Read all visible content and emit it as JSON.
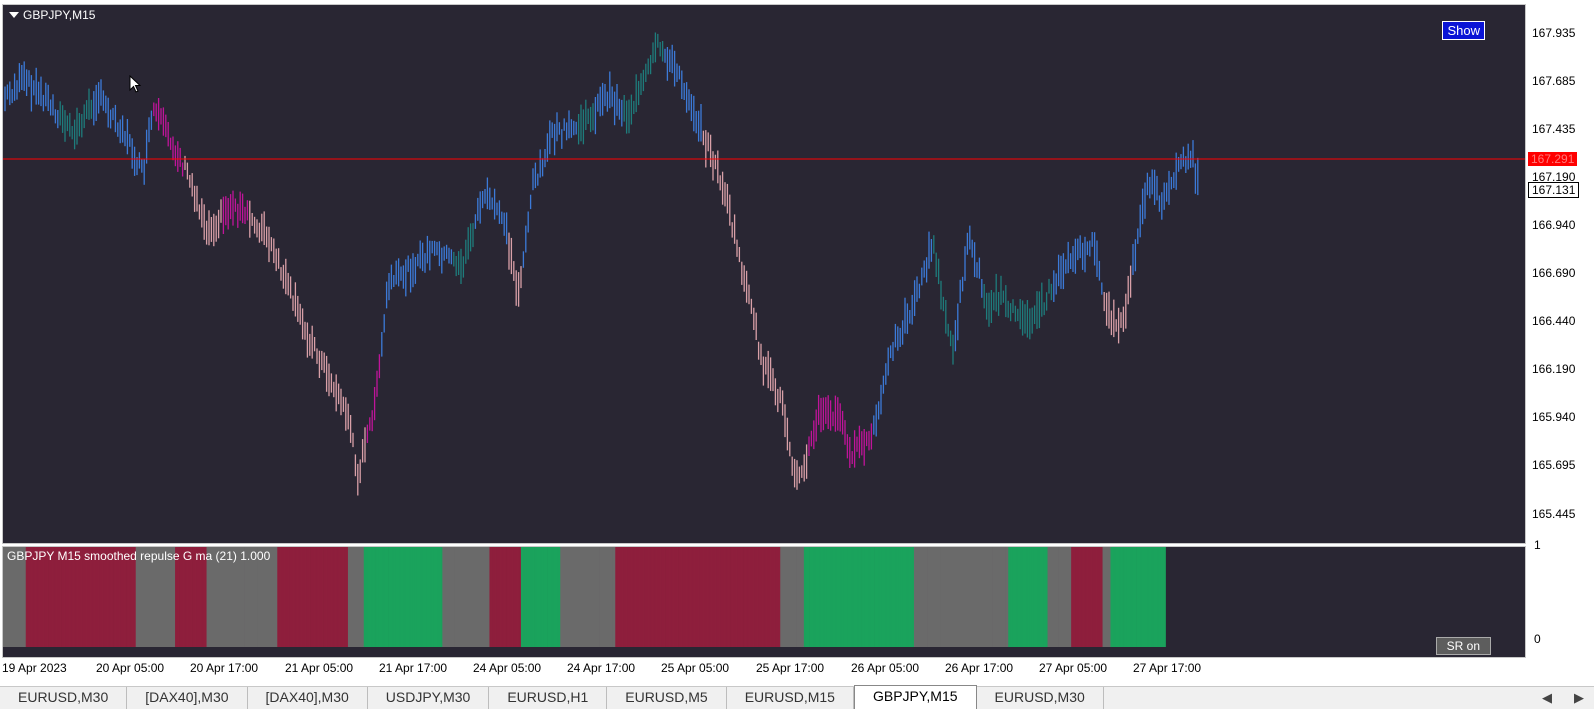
{
  "chart": {
    "title": "GBPJPY,M15",
    "show_button": "Show",
    "current_price": "167.291",
    "bid_price": "167.131",
    "price_ticks": [
      "167.935",
      "167.685",
      "167.435",
      "167.190",
      "166.940",
      "166.690",
      "166.440",
      "166.190",
      "165.940",
      "165.695",
      "165.445"
    ],
    "time_ticks": [
      "19 Apr 2023",
      "20 Apr 05:00",
      "20 Apr 17:00",
      "21 Apr 05:00",
      "21 Apr 17:00",
      "24 Apr 05:00",
      "24 Apr 17:00",
      "25 Apr 05:00",
      "25 Apr 17:00",
      "26 Apr 05:00",
      "26 Apr 17:00",
      "27 Apr 05:00",
      "27 Apr 17:00"
    ],
    "colors": {
      "background": "#292633",
      "bar_blue": "#3c7ad8",
      "bar_teal": "#1e7c7c",
      "bar_pink": "#d9a0a8",
      "bar_magenta": "#c0149a",
      "price_line": "#ff0000"
    }
  },
  "indicator": {
    "title": "GBPJPY M15 smoothed repulse G ma (21) 1.000",
    "scale_top": "1",
    "scale_bottom": "0",
    "sr_button": "SR on",
    "colors": {
      "red": "#8e1f3c",
      "green": "#1aa35c",
      "gray": "#6a6a6a"
    },
    "segments": [
      {
        "color": "gray",
        "bars": 3
      },
      {
        "color": "red",
        "bars": 14
      },
      {
        "color": "gray",
        "bars": 5
      },
      {
        "color": "red",
        "bars": 4
      },
      {
        "color": "gray",
        "bars": 9
      },
      {
        "color": "red",
        "bars": 9
      },
      {
        "color": "gray",
        "bars": 2
      },
      {
        "color": "green",
        "bars": 10
      },
      {
        "color": "gray",
        "bars": 6
      },
      {
        "color": "red",
        "bars": 4
      },
      {
        "color": "green",
        "bars": 5
      },
      {
        "color": "gray",
        "bars": 7
      },
      {
        "color": "red",
        "bars": 21
      },
      {
        "color": "gray",
        "bars": 3
      },
      {
        "color": "green",
        "bars": 14
      },
      {
        "color": "gray",
        "bars": 12
      },
      {
        "color": "green",
        "bars": 5
      },
      {
        "color": "gray",
        "bars": 3
      },
      {
        "color": "red",
        "bars": 4
      },
      {
        "color": "gray",
        "bars": 1
      },
      {
        "color": "green",
        "bars": 7
      }
    ]
  },
  "tabs": [
    {
      "label": "EURUSD,M30",
      "active": false
    },
    {
      "label": "[DAX40],M30",
      "active": false
    },
    {
      "label": "[DAX40],M30",
      "active": false
    },
    {
      "label": "USDJPY,M30",
      "active": false
    },
    {
      "label": "EURUSD,H1",
      "active": false
    },
    {
      "label": "EURUSD,M5",
      "active": false
    },
    {
      "label": "EURUSD,M15",
      "active": false
    },
    {
      "label": "GBPJPY,M15",
      "active": true
    },
    {
      "label": "EURUSD,M30",
      "active": false
    }
  ],
  "tab_nav": {
    "prev": "◀",
    "next": "▶"
  }
}
